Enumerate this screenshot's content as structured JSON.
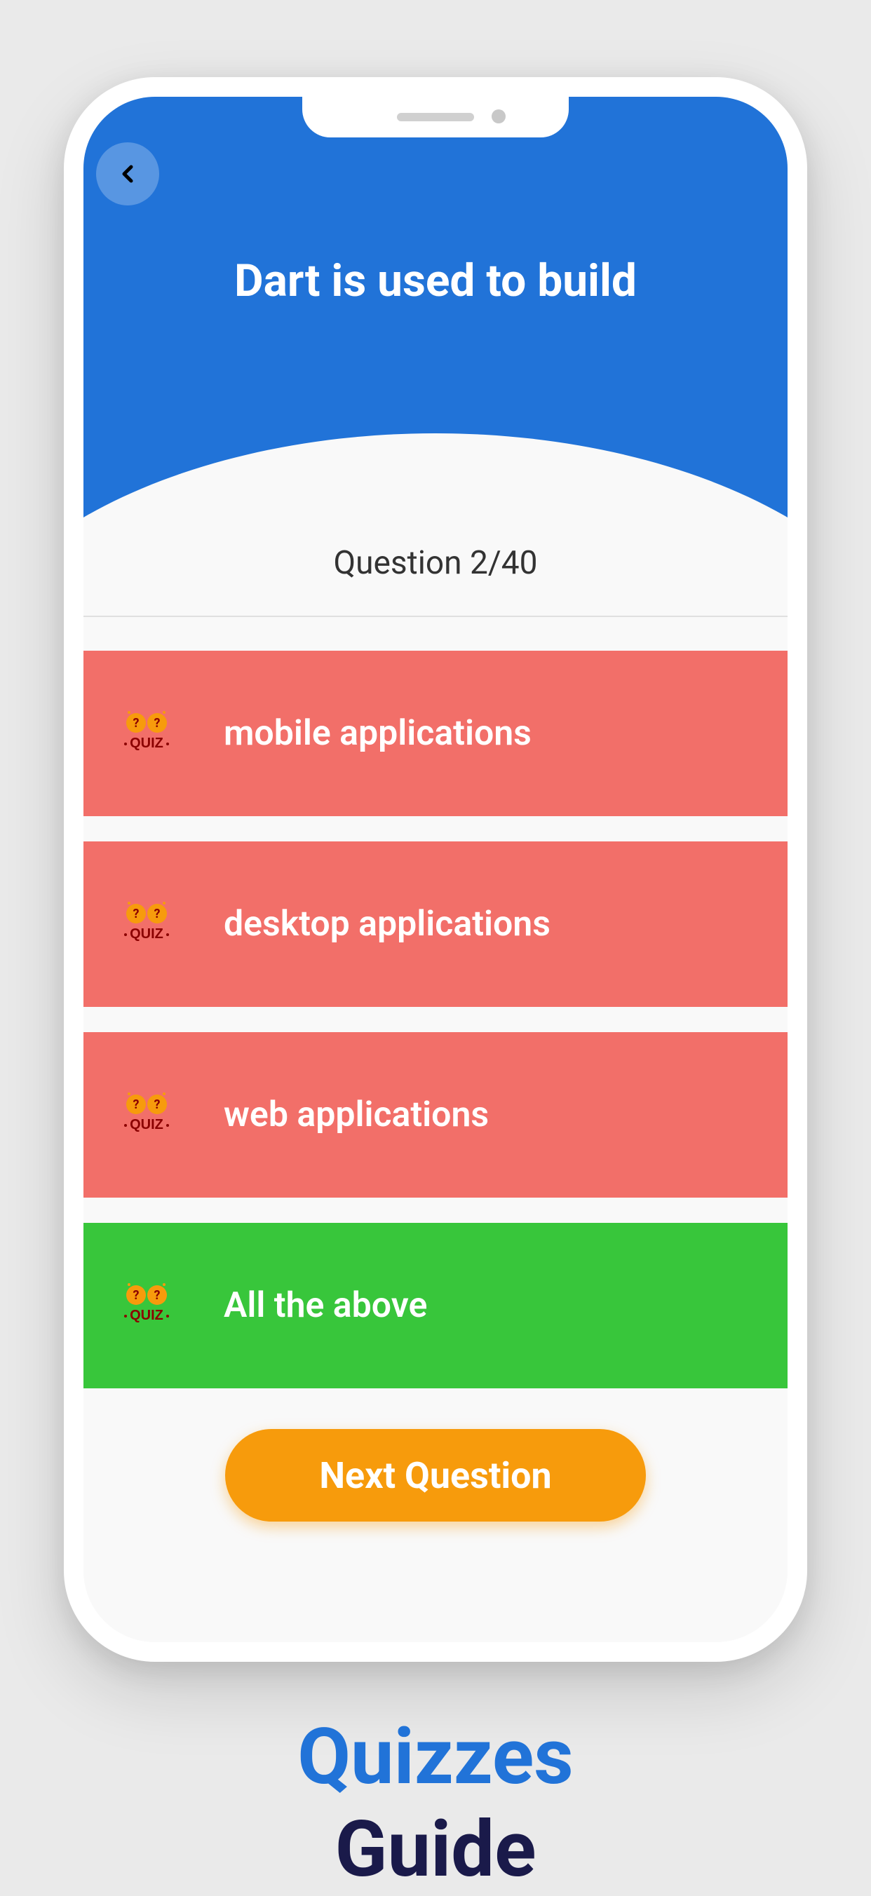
{
  "quiz": {
    "question": "Dart is used to build",
    "counter": "Question 2/40",
    "options": [
      {
        "text": "mobile applications",
        "correct": false
      },
      {
        "text": "desktop applications",
        "correct": false
      },
      {
        "text": "web applications",
        "correct": false
      },
      {
        "text": "All the above",
        "correct": true
      }
    ],
    "next_button": "Next Question",
    "icon_label": "QUIZ"
  },
  "caption": {
    "line1": "Quizzes",
    "line2": "Guide"
  }
}
